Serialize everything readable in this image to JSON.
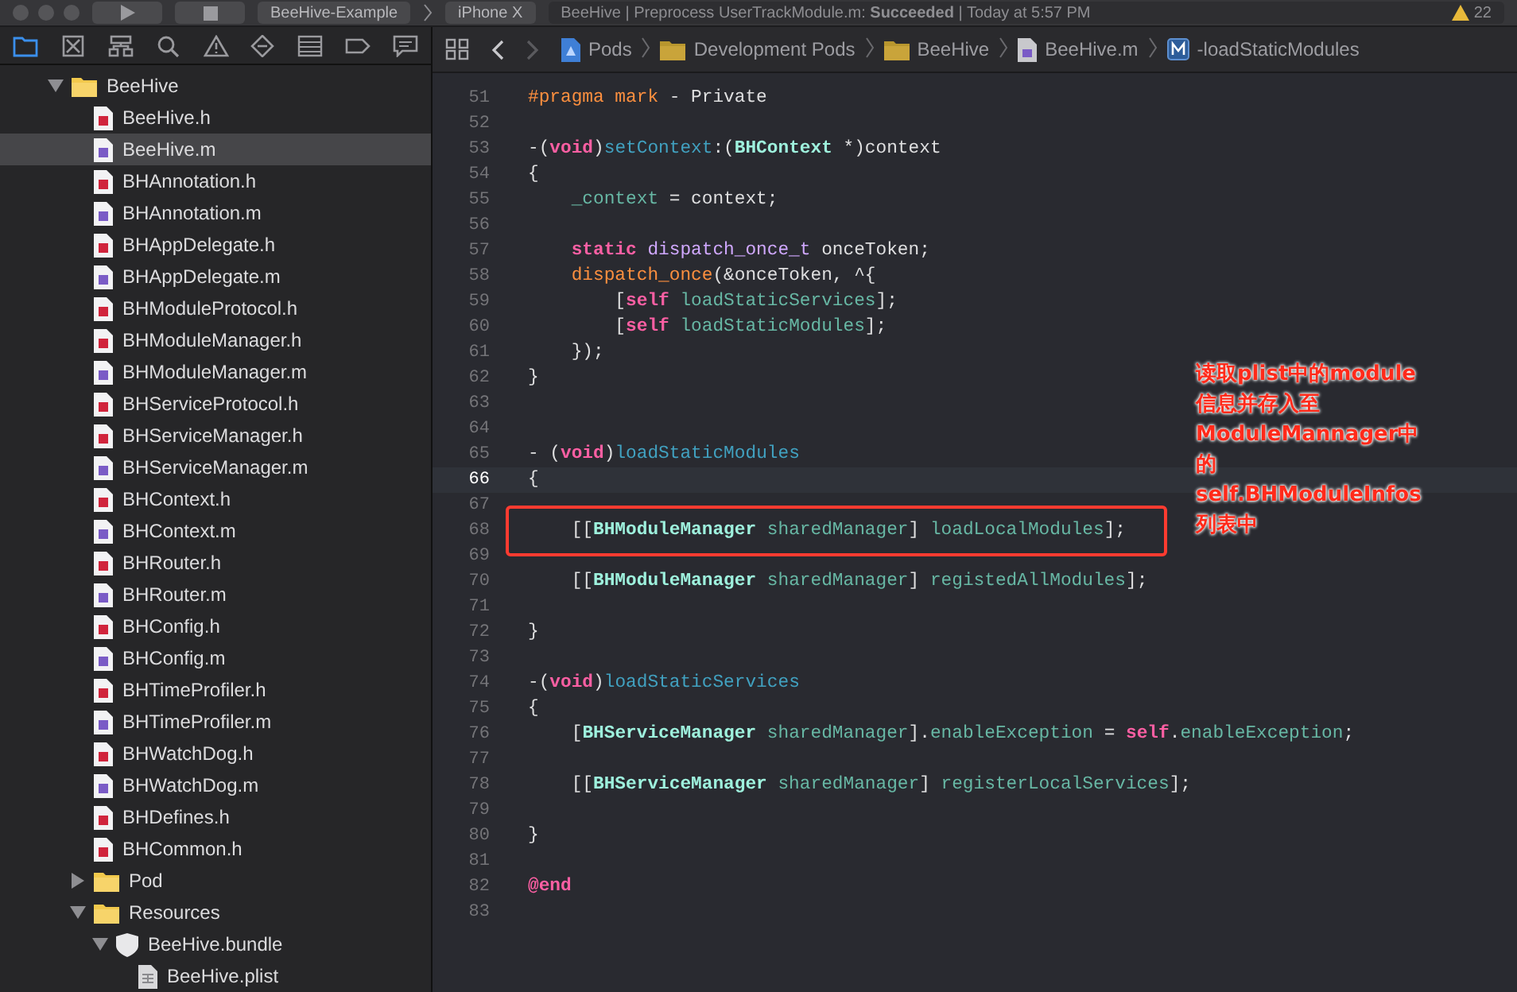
{
  "toolbar": {
    "scheme": "BeeHive-Example",
    "device": "iPhone X",
    "status": "BeeHive | Preprocess UserTrackModule.m: **Succeeded** | Today at 5:57 PM",
    "warnings": "22"
  },
  "navigator_tabs": [
    {
      "selected": true
    },
    {
      "selected": false
    },
    {
      "selected": false
    },
    {
      "selected": false
    },
    {
      "selected": false
    },
    {
      "selected": false
    },
    {
      "selected": false
    },
    {
      "selected": false
    },
    {
      "selected": false
    }
  ],
  "tree": [
    {
      "name": "BeeHive",
      "kind": "folder",
      "expanded": true,
      "selected": false,
      "children": [
        {
          "name": "BeeHive.h",
          "kind": "h",
          "selected": false
        },
        {
          "name": "BeeHive.m",
          "kind": "m",
          "selected": true
        },
        {
          "name": "BHAnnotation.h",
          "kind": "h",
          "selected": false
        },
        {
          "name": "BHAnnotation.m",
          "kind": "m",
          "selected": false
        },
        {
          "name": "BHAppDelegate.h",
          "kind": "h",
          "selected": false
        },
        {
          "name": "BHAppDelegate.m",
          "kind": "m",
          "selected": false
        },
        {
          "name": "BHModuleProtocol.h",
          "kind": "h",
          "selected": false
        },
        {
          "name": "BHModuleManager.h",
          "kind": "h",
          "selected": false
        },
        {
          "name": "BHModuleManager.m",
          "kind": "m",
          "selected": false
        },
        {
          "name": "BHServiceProtocol.h",
          "kind": "h",
          "selected": false
        },
        {
          "name": "BHServiceManager.h",
          "kind": "h",
          "selected": false
        },
        {
          "name": "BHServiceManager.m",
          "kind": "m",
          "selected": false
        },
        {
          "name": "BHContext.h",
          "kind": "h",
          "selected": false
        },
        {
          "name": "BHContext.m",
          "kind": "m",
          "selected": false
        },
        {
          "name": "BHRouter.h",
          "kind": "h",
          "selected": false
        },
        {
          "name": "BHRouter.m",
          "kind": "m",
          "selected": false
        },
        {
          "name": "BHConfig.h",
          "kind": "h",
          "selected": false
        },
        {
          "name": "BHConfig.m",
          "kind": "m",
          "selected": false
        },
        {
          "name": "BHTimeProfiler.h",
          "kind": "h",
          "selected": false
        },
        {
          "name": "BHTimeProfiler.m",
          "kind": "m",
          "selected": false
        },
        {
          "name": "BHWatchDog.h",
          "kind": "h",
          "selected": false
        },
        {
          "name": "BHWatchDog.m",
          "kind": "m",
          "selected": false
        },
        {
          "name": "BHDefines.h",
          "kind": "h",
          "selected": false
        },
        {
          "name": "BHCommon.h",
          "kind": "h",
          "selected": false
        },
        {
          "name": "Pod",
          "kind": "folder",
          "expanded": false,
          "selected": false
        },
        {
          "name": "Resources",
          "kind": "folder",
          "expanded": true,
          "selected": false,
          "children": [
            {
              "name": "BeeHive.bundle",
              "kind": "bundle",
              "expanded": true,
              "selected": false,
              "children": [
                {
                  "name": "BeeHive.plist",
                  "kind": "plist",
                  "selected": false
                }
              ]
            }
          ]
        }
      ]
    }
  ],
  "breadcrumb": [
    {
      "label": "Pods",
      "kind": "project"
    },
    {
      "label": "Development Pods",
      "kind": "folder"
    },
    {
      "label": "BeeHive",
      "kind": "folder"
    },
    {
      "label": "BeeHive.m",
      "kind": "file"
    },
    {
      "label": "-loadStaticModules",
      "kind": "method"
    }
  ],
  "code": [
    {
      "number": "51",
      "current": false,
      "tokens": [
        {
          "kind": "pp",
          "text": "#pragma mark"
        },
        {
          "kind": "plain",
          "text": " - Private"
        }
      ]
    },
    {
      "number": "52",
      "current": false
    },
    {
      "number": "53",
      "current": false,
      "tokens": [
        {
          "kind": "plain",
          "text": "-("
        },
        {
          "kind": "kw",
          "text": "void"
        },
        {
          "kind": "plain",
          "text": ")"
        },
        {
          "kind": "decl",
          "text": "setContext"
        },
        {
          "kind": "plain",
          "text": ":("
        },
        {
          "kind": "cls",
          "text": "BHContext"
        },
        {
          "kind": "plain",
          "text": " *)context"
        }
      ]
    },
    {
      "number": "54",
      "current": false,
      "tokens": [
        {
          "kind": "plain",
          "text": "{"
        }
      ]
    },
    {
      "number": "55",
      "current": false,
      "tokens": [
        {
          "kind": "method",
          "text": "    _context"
        },
        {
          "kind": "plain",
          "text": " = context;"
        }
      ]
    },
    {
      "number": "56",
      "current": false
    },
    {
      "number": "57",
      "current": false,
      "tokens": [
        {
          "kind": "kw",
          "text": "    static"
        },
        {
          "kind": "type",
          "text": " dispatch_once_t"
        },
        {
          "kind": "plain",
          "text": " onceToken;"
        }
      ]
    },
    {
      "number": "58",
      "current": false,
      "tokens": [
        {
          "kind": "pp",
          "text": "    dispatch_once"
        },
        {
          "kind": "plain",
          "text": "(&onceToken, ^{"
        }
      ]
    },
    {
      "number": "59",
      "current": false,
      "tokens": [
        {
          "kind": "plain",
          "text": "        ["
        },
        {
          "kind": "kw",
          "text": "self"
        },
        {
          "kind": "method",
          "text": " loadStaticServices"
        },
        {
          "kind": "plain",
          "text": "];"
        }
      ]
    },
    {
      "number": "60",
      "current": false,
      "tokens": [
        {
          "kind": "plain",
          "text": "        ["
        },
        {
          "kind": "kw",
          "text": "self"
        },
        {
          "kind": "method",
          "text": " loadStaticModules"
        },
        {
          "kind": "plain",
          "text": "];"
        }
      ]
    },
    {
      "number": "61",
      "current": false,
      "tokens": [
        {
          "kind": "plain",
          "text": "    });"
        }
      ]
    },
    {
      "number": "62",
      "current": false,
      "tokens": [
        {
          "kind": "plain",
          "text": "}"
        }
      ]
    },
    {
      "number": "63",
      "current": false
    },
    {
      "number": "64",
      "current": false
    },
    {
      "number": "65",
      "current": false,
      "tokens": [
        {
          "kind": "plain",
          "text": "- ("
        },
        {
          "kind": "kw",
          "text": "void"
        },
        {
          "kind": "plain",
          "text": ")"
        },
        {
          "kind": "decl",
          "text": "loadStaticModules"
        }
      ]
    },
    {
      "number": "66",
      "current": true,
      "tokens": [
        {
          "kind": "plain",
          "text": "{"
        }
      ]
    },
    {
      "number": "67",
      "current": false
    },
    {
      "number": "68",
      "current": false,
      "boxed": true,
      "tokens": [
        {
          "kind": "plain",
          "text": "    [["
        },
        {
          "kind": "cls",
          "text": "BHModuleManager"
        },
        {
          "kind": "method",
          "text": " sharedManager"
        },
        {
          "kind": "plain",
          "text": "] "
        },
        {
          "kind": "method",
          "text": "loadLocalModules"
        },
        {
          "kind": "plain",
          "text": "];"
        }
      ]
    },
    {
      "number": "69",
      "current": false
    },
    {
      "number": "70",
      "current": false,
      "tokens": [
        {
          "kind": "plain",
          "text": "    [["
        },
        {
          "kind": "cls",
          "text": "BHModuleManager"
        },
        {
          "kind": "method",
          "text": " sharedManager"
        },
        {
          "kind": "plain",
          "text": "] "
        },
        {
          "kind": "method",
          "text": "registedAllModules"
        },
        {
          "kind": "plain",
          "text": "];"
        }
      ]
    },
    {
      "number": "71",
      "current": false
    },
    {
      "number": "72",
      "current": false,
      "tokens": [
        {
          "kind": "plain",
          "text": "}"
        }
      ]
    },
    {
      "number": "73",
      "current": false
    },
    {
      "number": "74",
      "current": false,
      "tokens": [
        {
          "kind": "plain",
          "text": "-("
        },
        {
          "kind": "kw",
          "text": "void"
        },
        {
          "kind": "plain",
          "text": ")"
        },
        {
          "kind": "decl",
          "text": "loadStaticServices"
        }
      ]
    },
    {
      "number": "75",
      "current": false,
      "tokens": [
        {
          "kind": "plain",
          "text": "{"
        }
      ]
    },
    {
      "number": "76",
      "current": false,
      "tokens": [
        {
          "kind": "plain",
          "text": "    ["
        },
        {
          "kind": "cls",
          "text": "BHServiceManager"
        },
        {
          "kind": "method",
          "text": " sharedManager"
        },
        {
          "kind": "plain",
          "text": "]."
        },
        {
          "kind": "method",
          "text": "enableException"
        },
        {
          "kind": "plain",
          "text": " = "
        },
        {
          "kind": "kw",
          "text": "self"
        },
        {
          "kind": "plain",
          "text": "."
        },
        {
          "kind": "method",
          "text": "enableException"
        },
        {
          "kind": "plain",
          "text": ";"
        }
      ]
    },
    {
      "number": "77",
      "current": false
    },
    {
      "number": "78",
      "current": false,
      "tokens": [
        {
          "kind": "plain",
          "text": "    [["
        },
        {
          "kind": "cls",
          "text": "BHServiceManager"
        },
        {
          "kind": "method",
          "text": " sharedManager"
        },
        {
          "kind": "plain",
          "text": "] "
        },
        {
          "kind": "method",
          "text": "registerLocalServices"
        },
        {
          "kind": "plain",
          "text": "];"
        }
      ]
    },
    {
      "number": "79",
      "current": false
    },
    {
      "number": "80",
      "current": false,
      "tokens": [
        {
          "kind": "plain",
          "text": "}"
        }
      ]
    },
    {
      "number": "81",
      "current": false
    },
    {
      "number": "82",
      "current": false,
      "tokens": [
        {
          "kind": "kw",
          "text": "@end"
        }
      ]
    },
    {
      "number": "83",
      "current": false
    }
  ],
  "annotation": [
    "读取plist中的module",
    "信息并存入至",
    "ModuleMannager中",
    "的",
    "self.BHModuleInfos",
    "列表中"
  ]
}
